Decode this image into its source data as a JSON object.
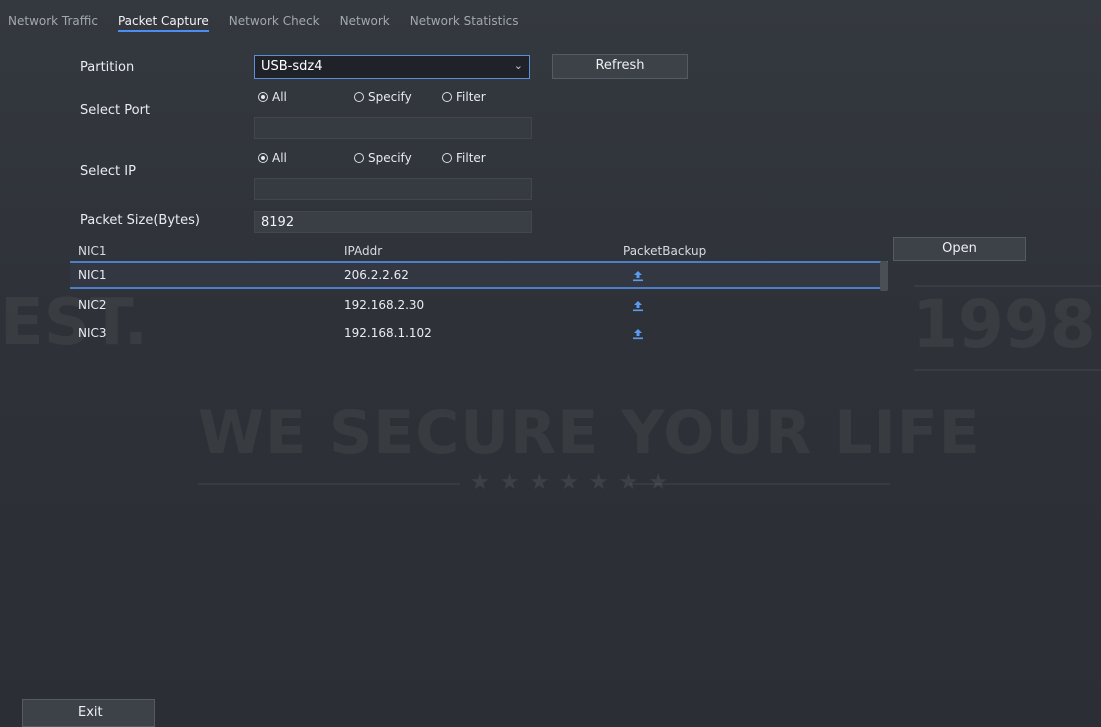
{
  "tabs": [
    {
      "label": "Network Traffic",
      "active": false
    },
    {
      "label": "Packet Capture",
      "active": true
    },
    {
      "label": "Network Check",
      "active": false
    },
    {
      "label": "Network",
      "active": false
    },
    {
      "label": "Network Statistics",
      "active": false
    }
  ],
  "form": {
    "partition_label": "Partition",
    "partition_value": "USB-sdz4",
    "refresh_label": "Refresh",
    "select_port_label": "Select Port",
    "select_ip_label": "Select IP",
    "radio_all": "All",
    "radio_specify": "Specify",
    "radio_filter": "Filter",
    "port_selected": "All",
    "ip_selected": "All",
    "packet_size_label": "Packet Size(Bytes)",
    "packet_size_value": "8192"
  },
  "table": {
    "headers": [
      "NIC1",
      "IPAddr",
      "PacketBackup"
    ],
    "rows": [
      {
        "nic": "NIC1",
        "ip": "206.2.2.62",
        "selected": true
      },
      {
        "nic": "NIC2",
        "ip": "192.168.2.30",
        "selected": false
      },
      {
        "nic": "NIC3",
        "ip": "192.168.1.102",
        "selected": false
      }
    ]
  },
  "open_label": "Open",
  "exit_label": "Exit",
  "watermark": {
    "slogan": "WE SECURE YOUR LIFE",
    "est": "EST.",
    "year": "1998",
    "stars": "★★★★★★★"
  },
  "colors": {
    "background": "#2b2f36",
    "accent": "#4a8ff0",
    "selected_row_border": "#4d7fc6",
    "upload_icon": "#5b9cf0"
  },
  "icons": {
    "dropdown": "chevron-down-icon",
    "backup": "upload-icon"
  }
}
